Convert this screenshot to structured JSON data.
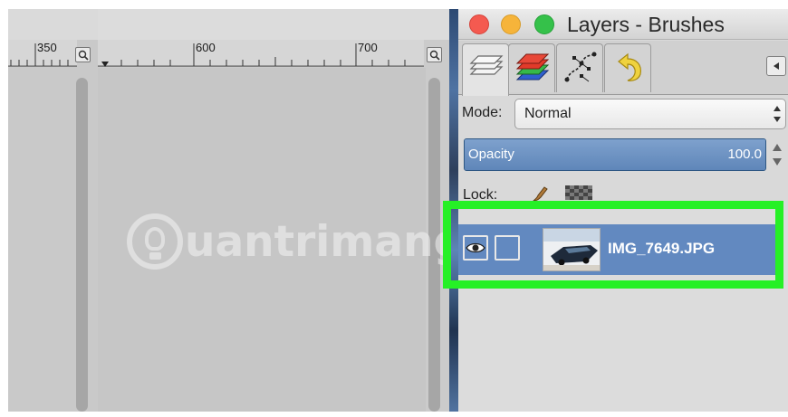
{
  "left_window": {
    "ruler_label": "350"
  },
  "main_window": {
    "ruler_labels": [
      "600",
      "700"
    ]
  },
  "watermark": {
    "text": "uantrimang"
  },
  "layers_panel": {
    "title": "Layers - Brushes",
    "tabs": [
      {
        "name": "layers-tab-icon"
      },
      {
        "name": "channels-tab-icon"
      },
      {
        "name": "paths-tab-icon"
      },
      {
        "name": "undo-history-tab-icon"
      }
    ],
    "mode_label": "Mode:",
    "mode_value": "Normal",
    "opacity_label": "Opacity",
    "opacity_value": "100.0",
    "opacity_fraction": 1.0,
    "lock_label": "Lock:",
    "layers": [
      {
        "name": "IMG_7649.JPG",
        "visible": true,
        "selected": true
      }
    ]
  },
  "colors": {
    "highlight": "#26f026",
    "selection": "#6289c0",
    "opacity_bar": "#6f93c2"
  }
}
